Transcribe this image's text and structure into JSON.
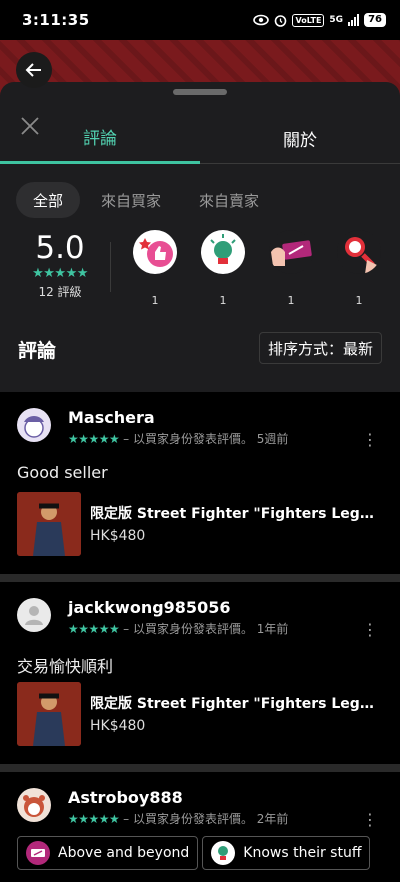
{
  "status_bar": {
    "time": "3:11:35",
    "network": "5G",
    "volte": "VoLTE",
    "battery": "76"
  },
  "tabs": [
    {
      "label": "評論"
    },
    {
      "label": "關於"
    }
  ],
  "filters": [
    {
      "label": "全部"
    },
    {
      "label": "來自買家"
    },
    {
      "label": "來自賣家"
    }
  ],
  "summary": {
    "score": "5.0",
    "stars": "★★★★★",
    "count_label": "12 評級"
  },
  "badges": [
    {
      "icon": "thumbs-up-star-icon",
      "count": "1"
    },
    {
      "icon": "lightbulb-icon",
      "count": "1"
    },
    {
      "icon": "ticket-hands-icon",
      "count": "1"
    },
    {
      "icon": "magnifier-icon",
      "count": "1"
    }
  ],
  "reviews_heading": "評論",
  "sort_label": "排序方式：最新",
  "reviews": [
    {
      "user": "Maschera",
      "stars": "★★★★★",
      "meta": "– 以買家身份發表評價。 5週前",
      "text": "Good seller",
      "item": {
        "title": "限定版 Street Fighter \"Fighters Legen…",
        "price": "HK$480"
      }
    },
    {
      "user": "jackkwong985056",
      "stars": "★★★★★",
      "meta": "– 以買家身份發表評價。 1年前",
      "text": "交易愉快順利",
      "item": {
        "title": "限定版 Street Fighter \"Fighters Legen…",
        "price": "HK$480"
      }
    },
    {
      "user": "Astroboy888",
      "stars": "★★★★★",
      "meta": "– 以買家身份發表評價。 2年前"
    }
  ],
  "tags": [
    {
      "label": "Above and beyond",
      "icon": "ticket-icon"
    },
    {
      "label": "Knows their stuff",
      "icon": "lightbulb-icon"
    }
  ],
  "colors": {
    "accent": "#3fc4a1",
    "sheet": "#1d1d1f",
    "background": "#000000",
    "header": "#7a1a1d"
  }
}
